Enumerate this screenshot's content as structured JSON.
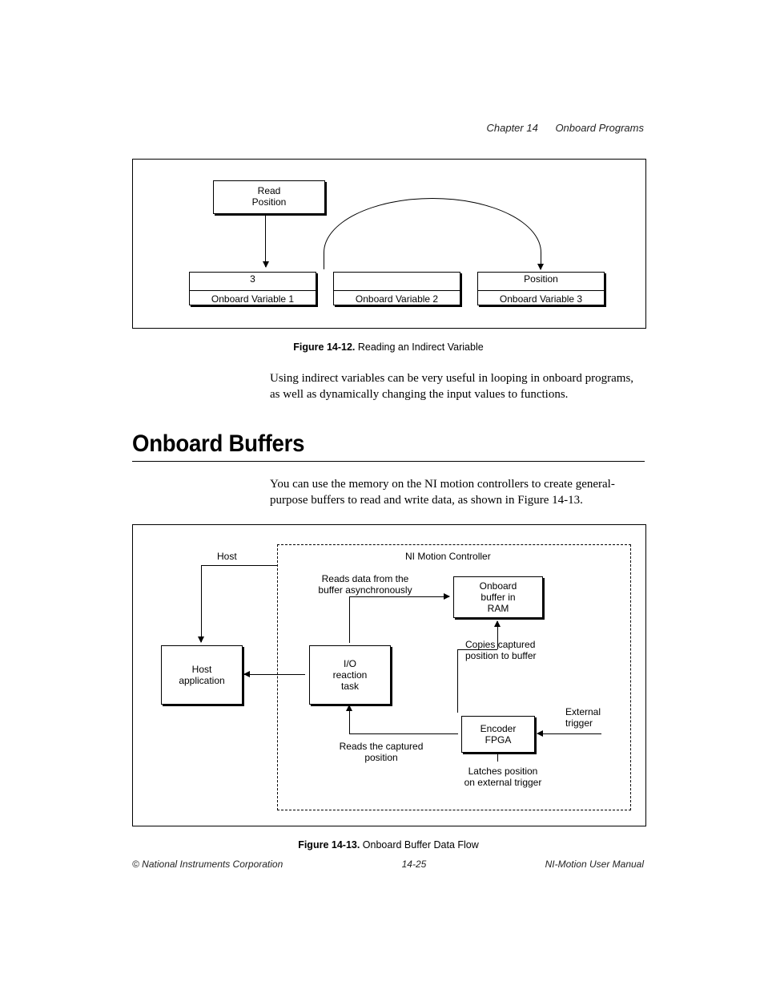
{
  "header": {
    "chapter": "Chapter 14",
    "title": "Onboard Programs"
  },
  "fig12": {
    "read_position": "Read\nPosition",
    "ov1_top": "3",
    "ov1_bot": "Onboard Variable 1",
    "ov2_top": "",
    "ov2_bot": "Onboard Variable 2",
    "ov3_top": "Position",
    "ov3_bot": "Onboard Variable 3",
    "caption_bold": "Figure 14-12.",
    "caption_rest": "  Reading an Indirect Variable"
  },
  "para1": "Using indirect variables can be very useful in looping in onboard programs, as well as dynamically changing the input values to functions.",
  "section_heading": "Onboard Buffers",
  "para2": "You can use the memory on the NI motion controllers to create general-purpose buffers to read and write data, as shown in Figure 14-13.",
  "fig13": {
    "host": "Host",
    "nim": "NI Motion Controller",
    "host_app": "Host\napplication",
    "io_task": "I/O\nreaction\ntask",
    "onb_buf": "Onboard\nbuffer in\nRAM",
    "encoder": "Encoder\nFPGA",
    "reads_async": "Reads data from the\nbuffer asynchronously",
    "copies": "Copies captured\nposition to buffer",
    "reads_cap": "Reads the captured\nposition",
    "ext_trig": "External\ntrigger",
    "latch": "Latches position\non external trigger",
    "caption_bold": "Figure 14-13.",
    "caption_rest": "  Onboard Buffer Data Flow"
  },
  "footer": {
    "left": "© National Instruments Corporation",
    "mid": "14-25",
    "right": "NI-Motion User Manual"
  }
}
